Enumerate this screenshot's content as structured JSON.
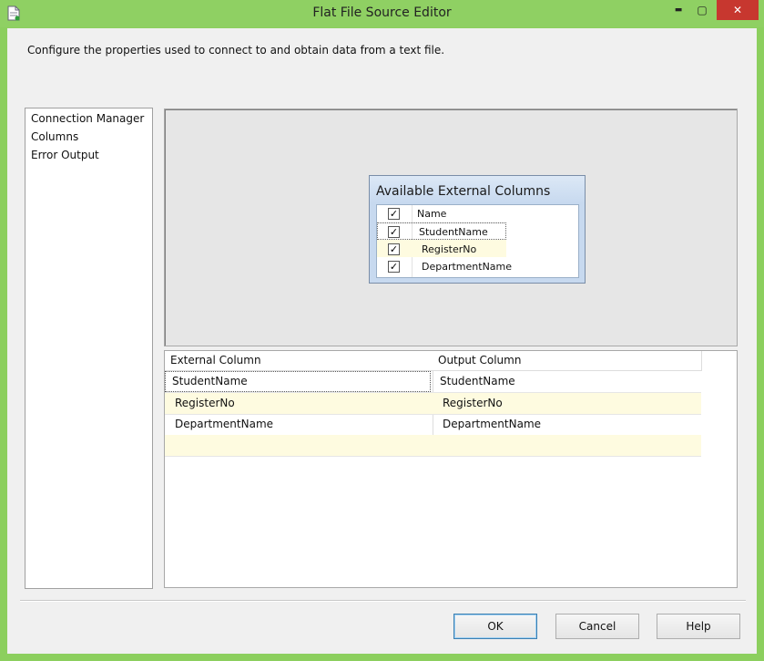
{
  "window": {
    "title": "Flat File Source Editor"
  },
  "titlebar": {
    "minimize": "▬",
    "maximize": "▢",
    "close": "✕"
  },
  "instruction": "Configure the properties used to connect to and obtain data from a text file.",
  "nav": {
    "items": [
      {
        "label": "Connection Manager"
      },
      {
        "label": "Columns"
      },
      {
        "label": "Error Output"
      }
    ]
  },
  "available": {
    "title": "Available External Columns",
    "header": "Name",
    "columns": [
      {
        "label": "StudentName",
        "checked": true
      },
      {
        "label": "RegisterNo",
        "checked": true
      },
      {
        "label": "DepartmentName",
        "checked": true
      }
    ]
  },
  "mapping": {
    "headers": [
      "External Column",
      "Output Column"
    ],
    "rows": [
      [
        "StudentName",
        "StudentName"
      ],
      [
        "RegisterNo",
        "RegisterNo"
      ],
      [
        "DepartmentName",
        "DepartmentName"
      ]
    ]
  },
  "buttons": {
    "ok": "OK",
    "cancel": "Cancel",
    "help": "Help"
  },
  "colors": {
    "titlebar": "#8fd063",
    "close": "#c7372f",
    "highlight_row": "#fefbe0",
    "panel": "#c7d9ef"
  }
}
